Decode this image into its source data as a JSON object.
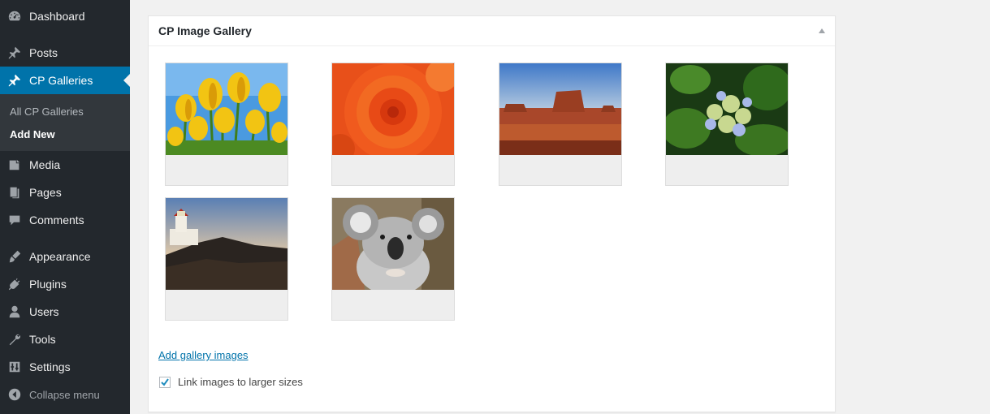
{
  "sidebar": {
    "items": [
      {
        "label": "Dashboard",
        "icon": "dashboard-icon"
      },
      {
        "label": "Posts",
        "icon": "pushpin-icon"
      },
      {
        "label": "CP Galleries",
        "icon": "pushpin-icon",
        "active": true
      },
      {
        "label": "Media",
        "icon": "media-icon"
      },
      {
        "label": "Pages",
        "icon": "pages-icon"
      },
      {
        "label": "Comments",
        "icon": "comment-icon"
      },
      {
        "label": "Appearance",
        "icon": "brush-icon"
      },
      {
        "label": "Plugins",
        "icon": "plug-icon"
      },
      {
        "label": "Users",
        "icon": "user-icon"
      },
      {
        "label": "Tools",
        "icon": "wrench-icon"
      },
      {
        "label": "Settings",
        "icon": "sliders-icon"
      }
    ],
    "submenu": [
      {
        "label": "All CP Galleries"
      },
      {
        "label": "Add New",
        "current": true
      }
    ],
    "collapse_label": "Collapse menu"
  },
  "metabox": {
    "title": "CP Image Gallery",
    "images": [
      {
        "subject": "yellow tulips"
      },
      {
        "subject": "orange chrysanthemum"
      },
      {
        "subject": "desert mesa"
      },
      {
        "subject": "hydrangea"
      },
      {
        "subject": "lighthouse"
      },
      {
        "subject": "koala"
      }
    ],
    "add_link": "Add gallery images",
    "checkbox_label": "Link images to larger sizes",
    "checkbox_checked": true
  },
  "colors": {
    "sidebar_bg": "#23282d",
    "submenu_bg": "#32373c",
    "active_bg": "#0073aa",
    "link": "#0073aa"
  }
}
